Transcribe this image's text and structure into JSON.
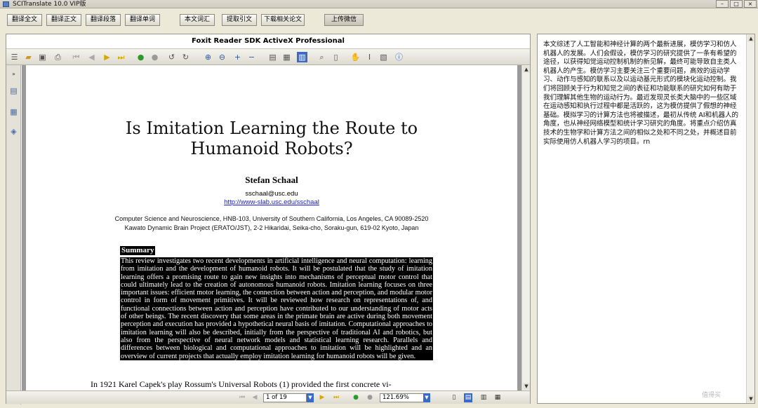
{
  "window": {
    "title": "SCITranslate 10.0 VIP版"
  },
  "toolbar_buttons": [
    {
      "label": "翻译全文"
    },
    {
      "label": "翻译正文"
    },
    {
      "label": "翻译段落"
    },
    {
      "label": "翻译单词"
    },
    {
      "label": "本文词汇"
    },
    {
      "label": "提取引文"
    },
    {
      "label": "下载相关论文"
    },
    {
      "label": "上传微信"
    }
  ],
  "viewer": {
    "title": "Foxit Reader SDK ActiveX Professional",
    "page_indicator": "1 of 19",
    "zoom": "121.69%"
  },
  "document": {
    "title_line1": "Is Imitation Learning the Route to",
    "title_line2": "Humanoid Robots?",
    "author": "Stefan Schaal",
    "email": "sschaal@usc.edu",
    "url": "http://www-slab.usc.edu/sschaal",
    "affiliation1": "Computer Science and Neuroscience, HNB-103, University of Southern California, Los Angeles, CA 90089-2520",
    "affiliation2": "Kawato Dynamic Brain Project (ERATO/JST), 2-2 Hikaridai, Seika-cho, Soraku-gun, 619-02 Kyoto, Japan",
    "summary_heading": "Summary",
    "summary_text": "This review investigates two recent developments in artificial intelligence and neural computation: learning from imitation and the development of humanoid robots. It will be postulated that the study of imitation learning offers a promising route to gain new insights into mechanisms of perceptual motor control that could ultimately lead to the creation of autonomous humanoid robots. Imitation learning focuses on three important issues: efficient motor learning, the connection between action and perception, and modular motor control in form of movement primitives. It will be reviewed how research on representations of, and functional connections between action and perception have contributed to our understanding of motor acts of other beings. The recent discovery that some areas in the primate brain are active during both movement perception and execution has provided a hypothetical neural basis of imitation. Computational approaches to imitation learning will also be described, initially from the perspective of traditional AI and robotics, but also from the perspective of neural network models and statistical learning research. Parallels and differences between biological and computational approaches to imitation will be highlighted and an overview of current projects that actually employ imitation learning for humanoid robots will be given.",
    "intro_start": "In 1921 Karel Capek's play Rossum's Universal Robots (1) provided the first concrete vi-"
  },
  "translation": {
    "text": "本文综述了人工智能和神经计算的两个最新进展，模仿学习和仿人机器人的发展。人们会假设，模仿学习的研究提供了一条有希望的途径，以获得知觉运动控制机制的新见解，最终可能导致自主类人机器人的产生。模仿学习主要关注三个重要问题，高效的运动学习、动作与感知的联系以及以运动基元形式的模块化运动控制。我们将回顾关于行为和知觉之间的表征和功能联系的研究如何有助于我们理解其他生物的运动行为。最近发现灵长类大脑中的一些区域在运动感知和执行过程中都是活跃的，这为模仿提供了假想的神经基础。模拟学习的计算方法也将被描述，最初从传统 AI和机器人的角度，也从神经网络模型和统计学习研究的角度。将重点介绍仿真技术的生物学和计算方法之间的相似之处和不同之处，并概述目前实际使用仿人机器人学习的项目。rn"
  },
  "watermark": "值得买"
}
